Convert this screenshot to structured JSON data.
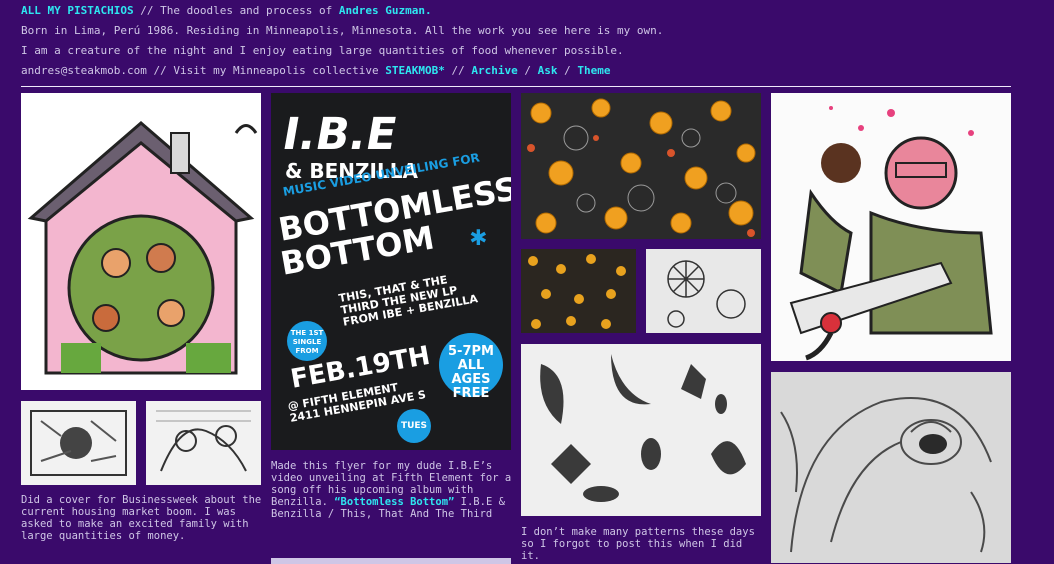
{
  "header": {
    "blog_title": "ALL MY PISTACHIOS",
    "sep1": " // ",
    "tagline_prefix": "The doodles and process of ",
    "author_name": "Andres Guzman.",
    "bio_line1": "Born in Lima, Perú 1986. Residing in Minneapolis, Minnesota. All the work you see here is my own.",
    "bio_line2": "I am a creature of the night and I enjoy eating large quantities of food whenever possible.",
    "email": "andres@steakmob.com",
    "sep2": " // ",
    "visit_text": "Visit my Minneapolis collective ",
    "collective_link": "STEAKMOB*",
    "sep3": " // ",
    "archive_link": "Archive",
    "sep4": " / ",
    "ask_link": "Ask",
    "sep5": " / ",
    "theme_link": "Theme"
  },
  "posts": {
    "housing": {
      "caption": "Did a cover for Businessweek about the current housing market boom. I was asked to make an excited family with large quantities of money."
    },
    "flyer": {
      "caption_prefix": "Made this flyer for my dude I.B.E’s video unveiling at Fifth Element for a song off his upcoming album with Benzilla.",
      "caption_link": "“Bottomless Bottom”",
      "caption_suffix": " I.B.E & Benzilla / This, That And The Third",
      "art": {
        "ibe": "I.B.E",
        "benzilla": "& BENZILLA",
        "music": "MUSIC VIDEO UNVEILING FOR",
        "bottomless": "BOTTOMLESS",
        "bottom": "BOTTOM",
        "arrow": "✱",
        "lp": "THIS, THAT & THE THIRD THE NEW LP FROM IBE + BENZILLA",
        "first_single": "THE 1ST SINGLE FROM",
        "date": "FEB.19TH",
        "venue": "@ FIFTH ELEMENT 2411 HENNEPIN AVE S",
        "time": "5-7PM ALL AGES FREE",
        "day": "TUES"
      }
    },
    "patterns": {
      "caption": "I don’t make many patterns these days so I forgot to post this when I did it."
    }
  },
  "colors": {
    "background": "#3a0a6b",
    "link": "#2ee6f0",
    "text": "#cfc6e6",
    "flyer_blue": "#1a9ee2"
  }
}
